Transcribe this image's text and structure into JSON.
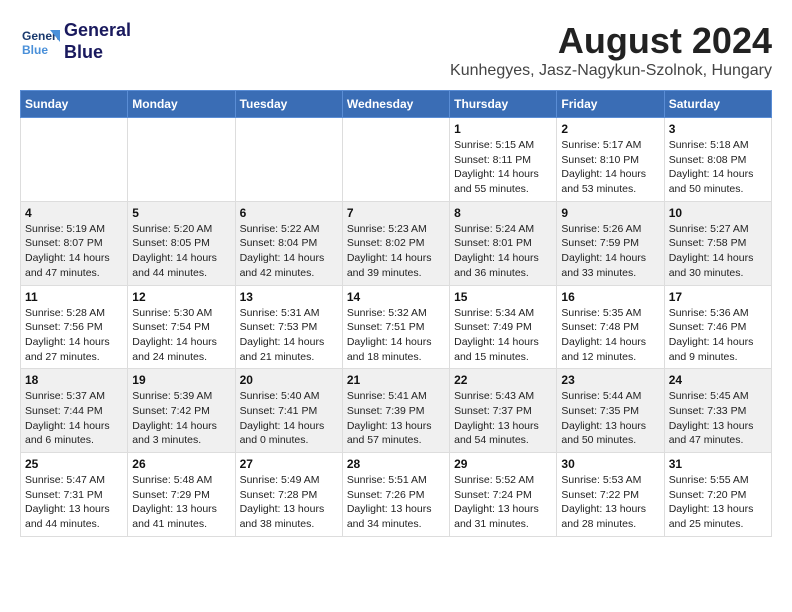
{
  "header": {
    "logo_line1": "General",
    "logo_line2": "Blue",
    "title": "August 2024",
    "subtitle": "Kunhegyes, Jasz-Nagykun-Szolnok, Hungary"
  },
  "days_of_week": [
    "Sunday",
    "Monday",
    "Tuesday",
    "Wednesday",
    "Thursday",
    "Friday",
    "Saturday"
  ],
  "weeks": [
    [
      {
        "day": "",
        "info": ""
      },
      {
        "day": "",
        "info": ""
      },
      {
        "day": "",
        "info": ""
      },
      {
        "day": "",
        "info": ""
      },
      {
        "day": "1",
        "info": "Sunrise: 5:15 AM\nSunset: 8:11 PM\nDaylight: 14 hours\nand 55 minutes."
      },
      {
        "day": "2",
        "info": "Sunrise: 5:17 AM\nSunset: 8:10 PM\nDaylight: 14 hours\nand 53 minutes."
      },
      {
        "day": "3",
        "info": "Sunrise: 5:18 AM\nSunset: 8:08 PM\nDaylight: 14 hours\nand 50 minutes."
      }
    ],
    [
      {
        "day": "4",
        "info": "Sunrise: 5:19 AM\nSunset: 8:07 PM\nDaylight: 14 hours\nand 47 minutes."
      },
      {
        "day": "5",
        "info": "Sunrise: 5:20 AM\nSunset: 8:05 PM\nDaylight: 14 hours\nand 44 minutes."
      },
      {
        "day": "6",
        "info": "Sunrise: 5:22 AM\nSunset: 8:04 PM\nDaylight: 14 hours\nand 42 minutes."
      },
      {
        "day": "7",
        "info": "Sunrise: 5:23 AM\nSunset: 8:02 PM\nDaylight: 14 hours\nand 39 minutes."
      },
      {
        "day": "8",
        "info": "Sunrise: 5:24 AM\nSunset: 8:01 PM\nDaylight: 14 hours\nand 36 minutes."
      },
      {
        "day": "9",
        "info": "Sunrise: 5:26 AM\nSunset: 7:59 PM\nDaylight: 14 hours\nand 33 minutes."
      },
      {
        "day": "10",
        "info": "Sunrise: 5:27 AM\nSunset: 7:58 PM\nDaylight: 14 hours\nand 30 minutes."
      }
    ],
    [
      {
        "day": "11",
        "info": "Sunrise: 5:28 AM\nSunset: 7:56 PM\nDaylight: 14 hours\nand 27 minutes."
      },
      {
        "day": "12",
        "info": "Sunrise: 5:30 AM\nSunset: 7:54 PM\nDaylight: 14 hours\nand 24 minutes."
      },
      {
        "day": "13",
        "info": "Sunrise: 5:31 AM\nSunset: 7:53 PM\nDaylight: 14 hours\nand 21 minutes."
      },
      {
        "day": "14",
        "info": "Sunrise: 5:32 AM\nSunset: 7:51 PM\nDaylight: 14 hours\nand 18 minutes."
      },
      {
        "day": "15",
        "info": "Sunrise: 5:34 AM\nSunset: 7:49 PM\nDaylight: 14 hours\nand 15 minutes."
      },
      {
        "day": "16",
        "info": "Sunrise: 5:35 AM\nSunset: 7:48 PM\nDaylight: 14 hours\nand 12 minutes."
      },
      {
        "day": "17",
        "info": "Sunrise: 5:36 AM\nSunset: 7:46 PM\nDaylight: 14 hours\nand 9 minutes."
      }
    ],
    [
      {
        "day": "18",
        "info": "Sunrise: 5:37 AM\nSunset: 7:44 PM\nDaylight: 14 hours\nand 6 minutes."
      },
      {
        "day": "19",
        "info": "Sunrise: 5:39 AM\nSunset: 7:42 PM\nDaylight: 14 hours\nand 3 minutes."
      },
      {
        "day": "20",
        "info": "Sunrise: 5:40 AM\nSunset: 7:41 PM\nDaylight: 14 hours\nand 0 minutes."
      },
      {
        "day": "21",
        "info": "Sunrise: 5:41 AM\nSunset: 7:39 PM\nDaylight: 13 hours\nand 57 minutes."
      },
      {
        "day": "22",
        "info": "Sunrise: 5:43 AM\nSunset: 7:37 PM\nDaylight: 13 hours\nand 54 minutes."
      },
      {
        "day": "23",
        "info": "Sunrise: 5:44 AM\nSunset: 7:35 PM\nDaylight: 13 hours\nand 50 minutes."
      },
      {
        "day": "24",
        "info": "Sunrise: 5:45 AM\nSunset: 7:33 PM\nDaylight: 13 hours\nand 47 minutes."
      }
    ],
    [
      {
        "day": "25",
        "info": "Sunrise: 5:47 AM\nSunset: 7:31 PM\nDaylight: 13 hours\nand 44 minutes."
      },
      {
        "day": "26",
        "info": "Sunrise: 5:48 AM\nSunset: 7:29 PM\nDaylight: 13 hours\nand 41 minutes."
      },
      {
        "day": "27",
        "info": "Sunrise: 5:49 AM\nSunset: 7:28 PM\nDaylight: 13 hours\nand 38 minutes."
      },
      {
        "day": "28",
        "info": "Sunrise: 5:51 AM\nSunset: 7:26 PM\nDaylight: 13 hours\nand 34 minutes."
      },
      {
        "day": "29",
        "info": "Sunrise: 5:52 AM\nSunset: 7:24 PM\nDaylight: 13 hours\nand 31 minutes."
      },
      {
        "day": "30",
        "info": "Sunrise: 5:53 AM\nSunset: 7:22 PM\nDaylight: 13 hours\nand 28 minutes."
      },
      {
        "day": "31",
        "info": "Sunrise: 5:55 AM\nSunset: 7:20 PM\nDaylight: 13 hours\nand 25 minutes."
      }
    ]
  ]
}
